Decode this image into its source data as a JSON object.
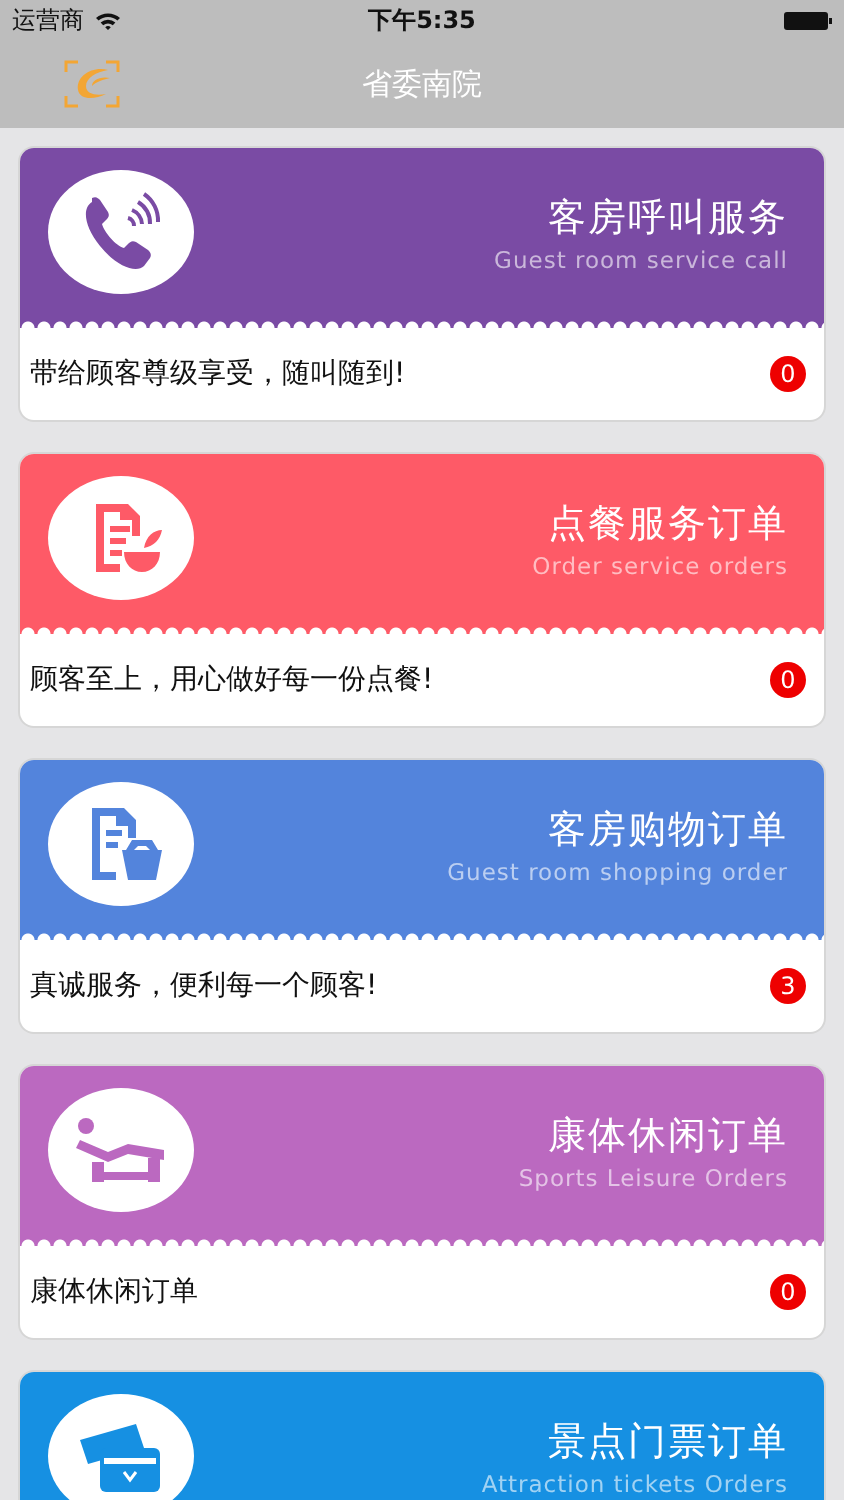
{
  "status_bar": {
    "carrier": "运营商",
    "time": "下午5:35"
  },
  "nav_bar": {
    "title": "省委南院"
  },
  "cards": [
    {
      "kind": "phone",
      "color": "#7a4ba4",
      "title": "客房呼叫服务",
      "subtitle": "Guest room service call",
      "description": "带给顾客尊级享受，随叫随到!",
      "count": "0"
    },
    {
      "kind": "meal",
      "color": "#fe5a67",
      "title": "点餐服务订单",
      "subtitle": "Order service orders",
      "description": "顾客至上，用心做好每一份点餐!",
      "count": "0"
    },
    {
      "kind": "shopping",
      "color": "#5384dc",
      "title": "客房购物订单",
      "subtitle": "Guest room shopping order",
      "description": "真诚服务，便利每一个顾客!",
      "count": "3"
    },
    {
      "kind": "lounge",
      "color": "#bb69c0",
      "title": "康体休闲订单",
      "subtitle": "Sports Leisure Orders",
      "description": "康体休闲订单",
      "count": "0"
    },
    {
      "kind": "ticket",
      "color": "#1690e2",
      "title": "景点门票订单",
      "subtitle": "Attraction tickets Orders"
    }
  ]
}
